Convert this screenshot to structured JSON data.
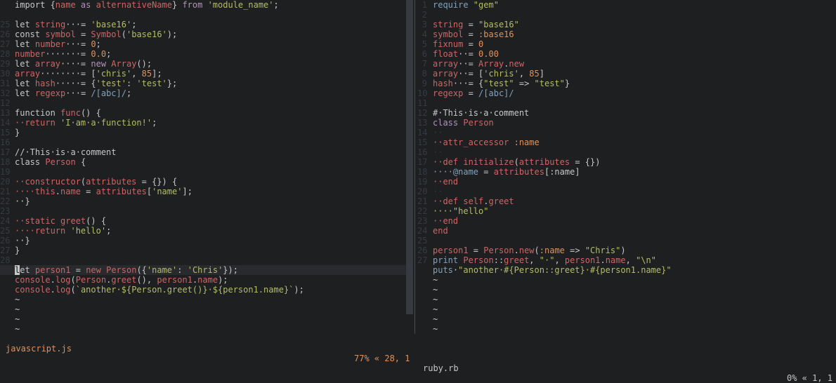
{
  "colors": {
    "background": "#1d1f21",
    "text": "#c5c8c6",
    "keyword": "#b294bb",
    "string": "#b5bd68",
    "number": "#de935f",
    "identifier": "#cc6666",
    "function": "#81a2be",
    "comment": "#969896",
    "whitespace": "#373b41"
  },
  "left_pane": {
    "file_name": "javascript.js",
    "position": "77% « 28, 1",
    "lines": [
      [
        {
          "t": "import {",
          "c": "text"
        },
        {
          "t": "name",
          "c": "identifier"
        },
        {
          "t": " as ",
          "c": "keyword"
        },
        {
          "t": "alternativeName",
          "c": "identifier"
        },
        {
          "t": "} ",
          "c": "text"
        },
        {
          "t": "from",
          "c": "keyword"
        },
        {
          "t": " ",
          "c": "text"
        },
        {
          "t": "'module_name'",
          "c": "string"
        },
        {
          "t": ";",
          "c": "text"
        }
      ],
      [
        {
          "t": "",
          "c": "text"
        }
      ],
      [
        {
          "t": "let ",
          "c": "text"
        },
        {
          "t": "string",
          "c": "identifier"
        },
        {
          "t": "···= ",
          "c": "text"
        },
        {
          "t": "'base16'",
          "c": "string"
        },
        {
          "t": ";",
          "c": "text"
        }
      ],
      [
        {
          "t": "const ",
          "c": "text"
        },
        {
          "t": "symbol",
          "c": "identifier"
        },
        {
          "t": " = ",
          "c": "text"
        },
        {
          "t": "Symbol",
          "c": "identifier"
        },
        {
          "t": "(",
          "c": "text"
        },
        {
          "t": "'base16'",
          "c": "string"
        },
        {
          "t": ");",
          "c": "text"
        }
      ],
      [
        {
          "t": "let ",
          "c": "text"
        },
        {
          "t": "number",
          "c": "identifier"
        },
        {
          "t": "···= ",
          "c": "text"
        },
        {
          "t": "0",
          "c": "number"
        },
        {
          "t": ";",
          "c": "text"
        }
      ],
      [
        {
          "t": "number",
          "c": "identifier"
        },
        {
          "t": "·······= ",
          "c": "text"
        },
        {
          "t": "0.0",
          "c": "number"
        },
        {
          "t": ";",
          "c": "text"
        }
      ],
      [
        {
          "t": "let ",
          "c": "text"
        },
        {
          "t": "array",
          "c": "identifier"
        },
        {
          "t": "····= ",
          "c": "text"
        },
        {
          "t": "new ",
          "c": "keyword"
        },
        {
          "t": "Array",
          "c": "identifier"
        },
        {
          "t": "();",
          "c": "text"
        }
      ],
      [
        {
          "t": "array",
          "c": "identifier"
        },
        {
          "t": "········= [",
          "c": "text"
        },
        {
          "t": "'chris'",
          "c": "string"
        },
        {
          "t": ", ",
          "c": "text"
        },
        {
          "t": "85",
          "c": "number"
        },
        {
          "t": "];",
          "c": "text"
        }
      ],
      [
        {
          "t": "let ",
          "c": "text"
        },
        {
          "t": "hash",
          "c": "identifier"
        },
        {
          "t": "·····= {",
          "c": "text"
        },
        {
          "t": "'test'",
          "c": "string"
        },
        {
          "t": ": ",
          "c": "text"
        },
        {
          "t": "'test'",
          "c": "string"
        },
        {
          "t": "};",
          "c": "text"
        }
      ],
      [
        {
          "t": "let ",
          "c": "text"
        },
        {
          "t": "regexp",
          "c": "identifier"
        },
        {
          "t": "···= ",
          "c": "text"
        },
        {
          "t": "/[abc]/",
          "c": "function"
        },
        {
          "t": ";",
          "c": "text"
        }
      ],
      [
        {
          "t": "",
          "c": "text"
        }
      ],
      [
        {
          "t": "function ",
          "c": "text"
        },
        {
          "t": "func",
          "c": "identifier"
        },
        {
          "t": "() {",
          "c": "text"
        }
      ],
      [
        {
          "t": "··return ",
          "c": "identifier"
        },
        {
          "t": "'I·am·a·function!'",
          "c": "string"
        },
        {
          "t": ";",
          "c": "text"
        }
      ],
      [
        {
          "t": "}",
          "c": "text"
        }
      ],
      [
        {
          "t": "",
          "c": "text"
        }
      ],
      [
        {
          "t": "//·This·is·a·comment",
          "c": "text"
        }
      ],
      [
        {
          "t": "class ",
          "c": "text"
        },
        {
          "t": "Person",
          "c": "identifier"
        },
        {
          "t": " {",
          "c": "text"
        }
      ],
      [
        {
          "t": "",
          "c": "text"
        }
      ],
      [
        {
          "t": "··constructor",
          "c": "identifier"
        },
        {
          "t": "(",
          "c": "text"
        },
        {
          "t": "attributes",
          "c": "identifier"
        },
        {
          "t": " = {}) {",
          "c": "text"
        }
      ],
      [
        {
          "t": "····this",
          "c": "identifier"
        },
        {
          "t": ".",
          "c": "text"
        },
        {
          "t": "name",
          "c": "identifier"
        },
        {
          "t": " = ",
          "c": "text"
        },
        {
          "t": "attributes",
          "c": "identifier"
        },
        {
          "t": "[",
          "c": "text"
        },
        {
          "t": "'name'",
          "c": "string"
        },
        {
          "t": "];",
          "c": "text"
        }
      ],
      [
        {
          "t": "··}",
          "c": "text"
        }
      ],
      [
        {
          "t": "",
          "c": "text"
        }
      ],
      [
        {
          "t": "··static ",
          "c": "identifier"
        },
        {
          "t": "greet",
          "c": "identifier"
        },
        {
          "t": "() {",
          "c": "text"
        }
      ],
      [
        {
          "t": "····return ",
          "c": "identifier"
        },
        {
          "t": "'hello'",
          "c": "string"
        },
        {
          "t": ";",
          "c": "text"
        }
      ],
      [
        {
          "t": "··}",
          "c": "text"
        }
      ],
      [
        {
          "t": "}",
          "c": "text"
        }
      ],
      [
        {
          "t": "",
          "c": "text"
        }
      ],
      [
        {
          "t": "let ",
          "c": "text"
        },
        {
          "t": "person1",
          "c": "identifier"
        },
        {
          "t": " = ",
          "c": "text"
        },
        {
          "t": "new ",
          "c": "identifier"
        },
        {
          "t": "Person",
          "c": "identifier"
        },
        {
          "t": "({",
          "c": "text"
        },
        {
          "t": "'name'",
          "c": "string"
        },
        {
          "t": ": ",
          "c": "text"
        },
        {
          "t": "'Chris'",
          "c": "string"
        },
        {
          "t": "});",
          "c": "text"
        }
      ],
      [
        {
          "t": "console",
          "c": "identifier"
        },
        {
          "t": ".",
          "c": "text"
        },
        {
          "t": "log",
          "c": "identifier"
        },
        {
          "t": "(",
          "c": "text"
        },
        {
          "t": "Person",
          "c": "identifier"
        },
        {
          "t": ".",
          "c": "text"
        },
        {
          "t": "greet",
          "c": "identifier"
        },
        {
          "t": "(), ",
          "c": "text"
        },
        {
          "t": "person1",
          "c": "identifier"
        },
        {
          "t": ".",
          "c": "text"
        },
        {
          "t": "name",
          "c": "identifier"
        },
        {
          "t": ");",
          "c": "text"
        }
      ],
      [
        {
          "t": "console",
          "c": "identifier"
        },
        {
          "t": ".",
          "c": "text"
        },
        {
          "t": "log",
          "c": "identifier"
        },
        {
          "t": "(",
          "c": "text"
        },
        {
          "t": "`another·${Person.greet()}·${person1.name}`",
          "c": "string"
        },
        {
          "t": ");",
          "c": "text"
        }
      ]
    ],
    "line_numbers": [
      "",
      "",
      "25",
      "26",
      "27",
      "28",
      "29",
      "30",
      "31",
      "32",
      "12",
      "13",
      "14",
      "15",
      "16",
      "17",
      "18",
      "19",
      "20",
      "21",
      "22",
      "23",
      "24",
      "25",
      "26",
      "27",
      "28",
      "",
      "",
      ""
    ],
    "cursor_line_index": 27,
    "tildes": [
      "~",
      "~",
      "~",
      "~"
    ]
  },
  "right_pane": {
    "file_name": "ruby.rb",
    "position": "0% « 1, 1",
    "lines": [
      [
        {
          "t": "require ",
          "c": "function"
        },
        {
          "t": "\"gem\"",
          "c": "string"
        }
      ],
      [
        {
          "t": "",
          "c": "text"
        }
      ],
      [
        {
          "t": "string",
          "c": "identifier"
        },
        {
          "t": " = ",
          "c": "text"
        },
        {
          "t": "\"base16\"",
          "c": "string"
        }
      ],
      [
        {
          "t": "symbol",
          "c": "identifier"
        },
        {
          "t": " = ",
          "c": "text"
        },
        {
          "t": ":base16",
          "c": "number"
        }
      ],
      [
        {
          "t": "fixnum",
          "c": "identifier"
        },
        {
          "t": " = ",
          "c": "text"
        },
        {
          "t": "0",
          "c": "number"
        }
      ],
      [
        {
          "t": "float",
          "c": "identifier"
        },
        {
          "t": "··= ",
          "c": "text"
        },
        {
          "t": "0.00",
          "c": "number"
        }
      ],
      [
        {
          "t": "array",
          "c": "identifier"
        },
        {
          "t": "··= ",
          "c": "text"
        },
        {
          "t": "Array",
          "c": "identifier"
        },
        {
          "t": ".",
          "c": "text"
        },
        {
          "t": "new",
          "c": "identifier"
        }
      ],
      [
        {
          "t": "array",
          "c": "identifier"
        },
        {
          "t": "··= [",
          "c": "text"
        },
        {
          "t": "'chris'",
          "c": "string"
        },
        {
          "t": ", ",
          "c": "text"
        },
        {
          "t": "85",
          "c": "number"
        },
        {
          "t": "]",
          "c": "text"
        }
      ],
      [
        {
          "t": "hash",
          "c": "identifier"
        },
        {
          "t": "···= {",
          "c": "text"
        },
        {
          "t": "\"test\"",
          "c": "string"
        },
        {
          "t": " => ",
          "c": "text"
        },
        {
          "t": "\"test\"",
          "c": "string"
        },
        {
          "t": "}",
          "c": "text"
        }
      ],
      [
        {
          "t": "regexp",
          "c": "identifier"
        },
        {
          "t": " = ",
          "c": "text"
        },
        {
          "t": "/[abc]/",
          "c": "function"
        }
      ],
      [
        {
          "t": "",
          "c": "text"
        }
      ],
      [
        {
          "t": "#·This·is·a·comment",
          "c": "text"
        }
      ],
      [
        {
          "t": "class ",
          "c": "keyword"
        },
        {
          "t": "Person",
          "c": "identifier"
        }
      ],
      [
        {
          "t": "··",
          "c": "whitespace"
        }
      ],
      [
        {
          "t": "··attr_accessor ",
          "c": "identifier"
        },
        {
          "t": ":name",
          "c": "number"
        }
      ],
      [
        {
          "t": "··",
          "c": "whitespace"
        }
      ],
      [
        {
          "t": "··def ",
          "c": "identifier"
        },
        {
          "t": "initialize",
          "c": "identifier"
        },
        {
          "t": "(",
          "c": "text"
        },
        {
          "t": "attributes",
          "c": "identifier"
        },
        {
          "t": " = {})",
          "c": "text"
        }
      ],
      [
        {
          "t": "····@name",
          "c": "function"
        },
        {
          "t": " = ",
          "c": "text"
        },
        {
          "t": "attributes",
          "c": "identifier"
        },
        {
          "t": "[:name]",
          "c": "text"
        }
      ],
      [
        {
          "t": "··end",
          "c": "identifier"
        }
      ],
      [
        {
          "t": "··",
          "c": "whitespace"
        }
      ],
      [
        {
          "t": "··def ",
          "c": "identifier"
        },
        {
          "t": "self",
          "c": "identifier"
        },
        {
          "t": ".",
          "c": "text"
        },
        {
          "t": "greet",
          "c": "identifier"
        }
      ],
      [
        {
          "t": "····\"hello\"",
          "c": "string"
        }
      ],
      [
        {
          "t": "··end",
          "c": "identifier"
        }
      ],
      [
        {
          "t": "end",
          "c": "identifier"
        }
      ],
      [
        {
          "t": "",
          "c": "text"
        }
      ],
      [
        {
          "t": "person1",
          "c": "identifier"
        },
        {
          "t": " = ",
          "c": "text"
        },
        {
          "t": "Person",
          "c": "identifier"
        },
        {
          "t": ".",
          "c": "text"
        },
        {
          "t": "new",
          "c": "identifier"
        },
        {
          "t": "(",
          "c": "text"
        },
        {
          "t": ":name",
          "c": "number"
        },
        {
          "t": " => ",
          "c": "text"
        },
        {
          "t": "\"Chris\"",
          "c": "string"
        },
        {
          "t": ")",
          "c": "text"
        }
      ],
      [
        {
          "t": "print ",
          "c": "function"
        },
        {
          "t": "Person",
          "c": "identifier"
        },
        {
          "t": "::",
          "c": "text"
        },
        {
          "t": "greet",
          "c": "identifier"
        },
        {
          "t": ", ",
          "c": "text"
        },
        {
          "t": "\"·\"",
          "c": "string"
        },
        {
          "t": ", ",
          "c": "text"
        },
        {
          "t": "person1",
          "c": "identifier"
        },
        {
          "t": ".",
          "c": "text"
        },
        {
          "t": "name",
          "c": "identifier"
        },
        {
          "t": ", ",
          "c": "text"
        },
        {
          "t": "\"\\n\"",
          "c": "string"
        }
      ],
      [
        {
          "t": "puts",
          "c": "function"
        },
        {
          "t": "·",
          "c": "text"
        },
        {
          "t": "\"another·#{Person::greet}·#{person1.name}\"",
          "c": "string"
        }
      ]
    ],
    "line_numbers": [
      "1",
      "2",
      "3",
      "4",
      "5",
      "6",
      "7",
      "8",
      "9",
      "10",
      "11",
      "12",
      "13",
      "14",
      "15",
      "16",
      "17",
      "18",
      "19",
      "20",
      "21",
      "22",
      "23",
      "24",
      "25",
      "26",
      "27"
    ],
    "tildes": [
      "~",
      "~",
      "~",
      "~",
      "~",
      "~"
    ]
  }
}
